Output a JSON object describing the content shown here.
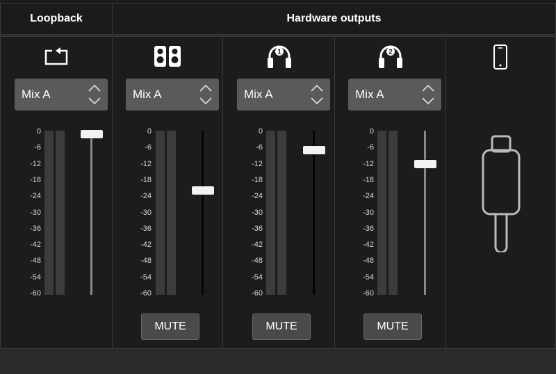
{
  "headers": {
    "loopback": "Loopback",
    "hardware": "Hardware outputs"
  },
  "scale_labels": [
    "0",
    "-6",
    "-12",
    "-18",
    "-24",
    "-30",
    "-36",
    "-42",
    "-48",
    "-54",
    "-60"
  ],
  "channels": [
    {
      "id": "loopback",
      "icon": "loopback-icon",
      "mix": "Mix A",
      "fader_db": -1,
      "mute": null
    },
    {
      "id": "speakers",
      "icon": "speakers-icon",
      "mix": "Mix A",
      "fader_db": -22,
      "mute": "MUTE"
    },
    {
      "id": "headphones-1",
      "icon": "headphones-1-icon",
      "mix": "Mix A",
      "fader_db": -7,
      "mute": "MUTE"
    },
    {
      "id": "headphones-2",
      "icon": "headphones-2-icon",
      "mix": "Mix A",
      "fader_db": -12,
      "mute": "MUTE"
    }
  ],
  "device": {
    "icon": "phone-icon",
    "cable_icon": "usb-c-cable-icon"
  }
}
